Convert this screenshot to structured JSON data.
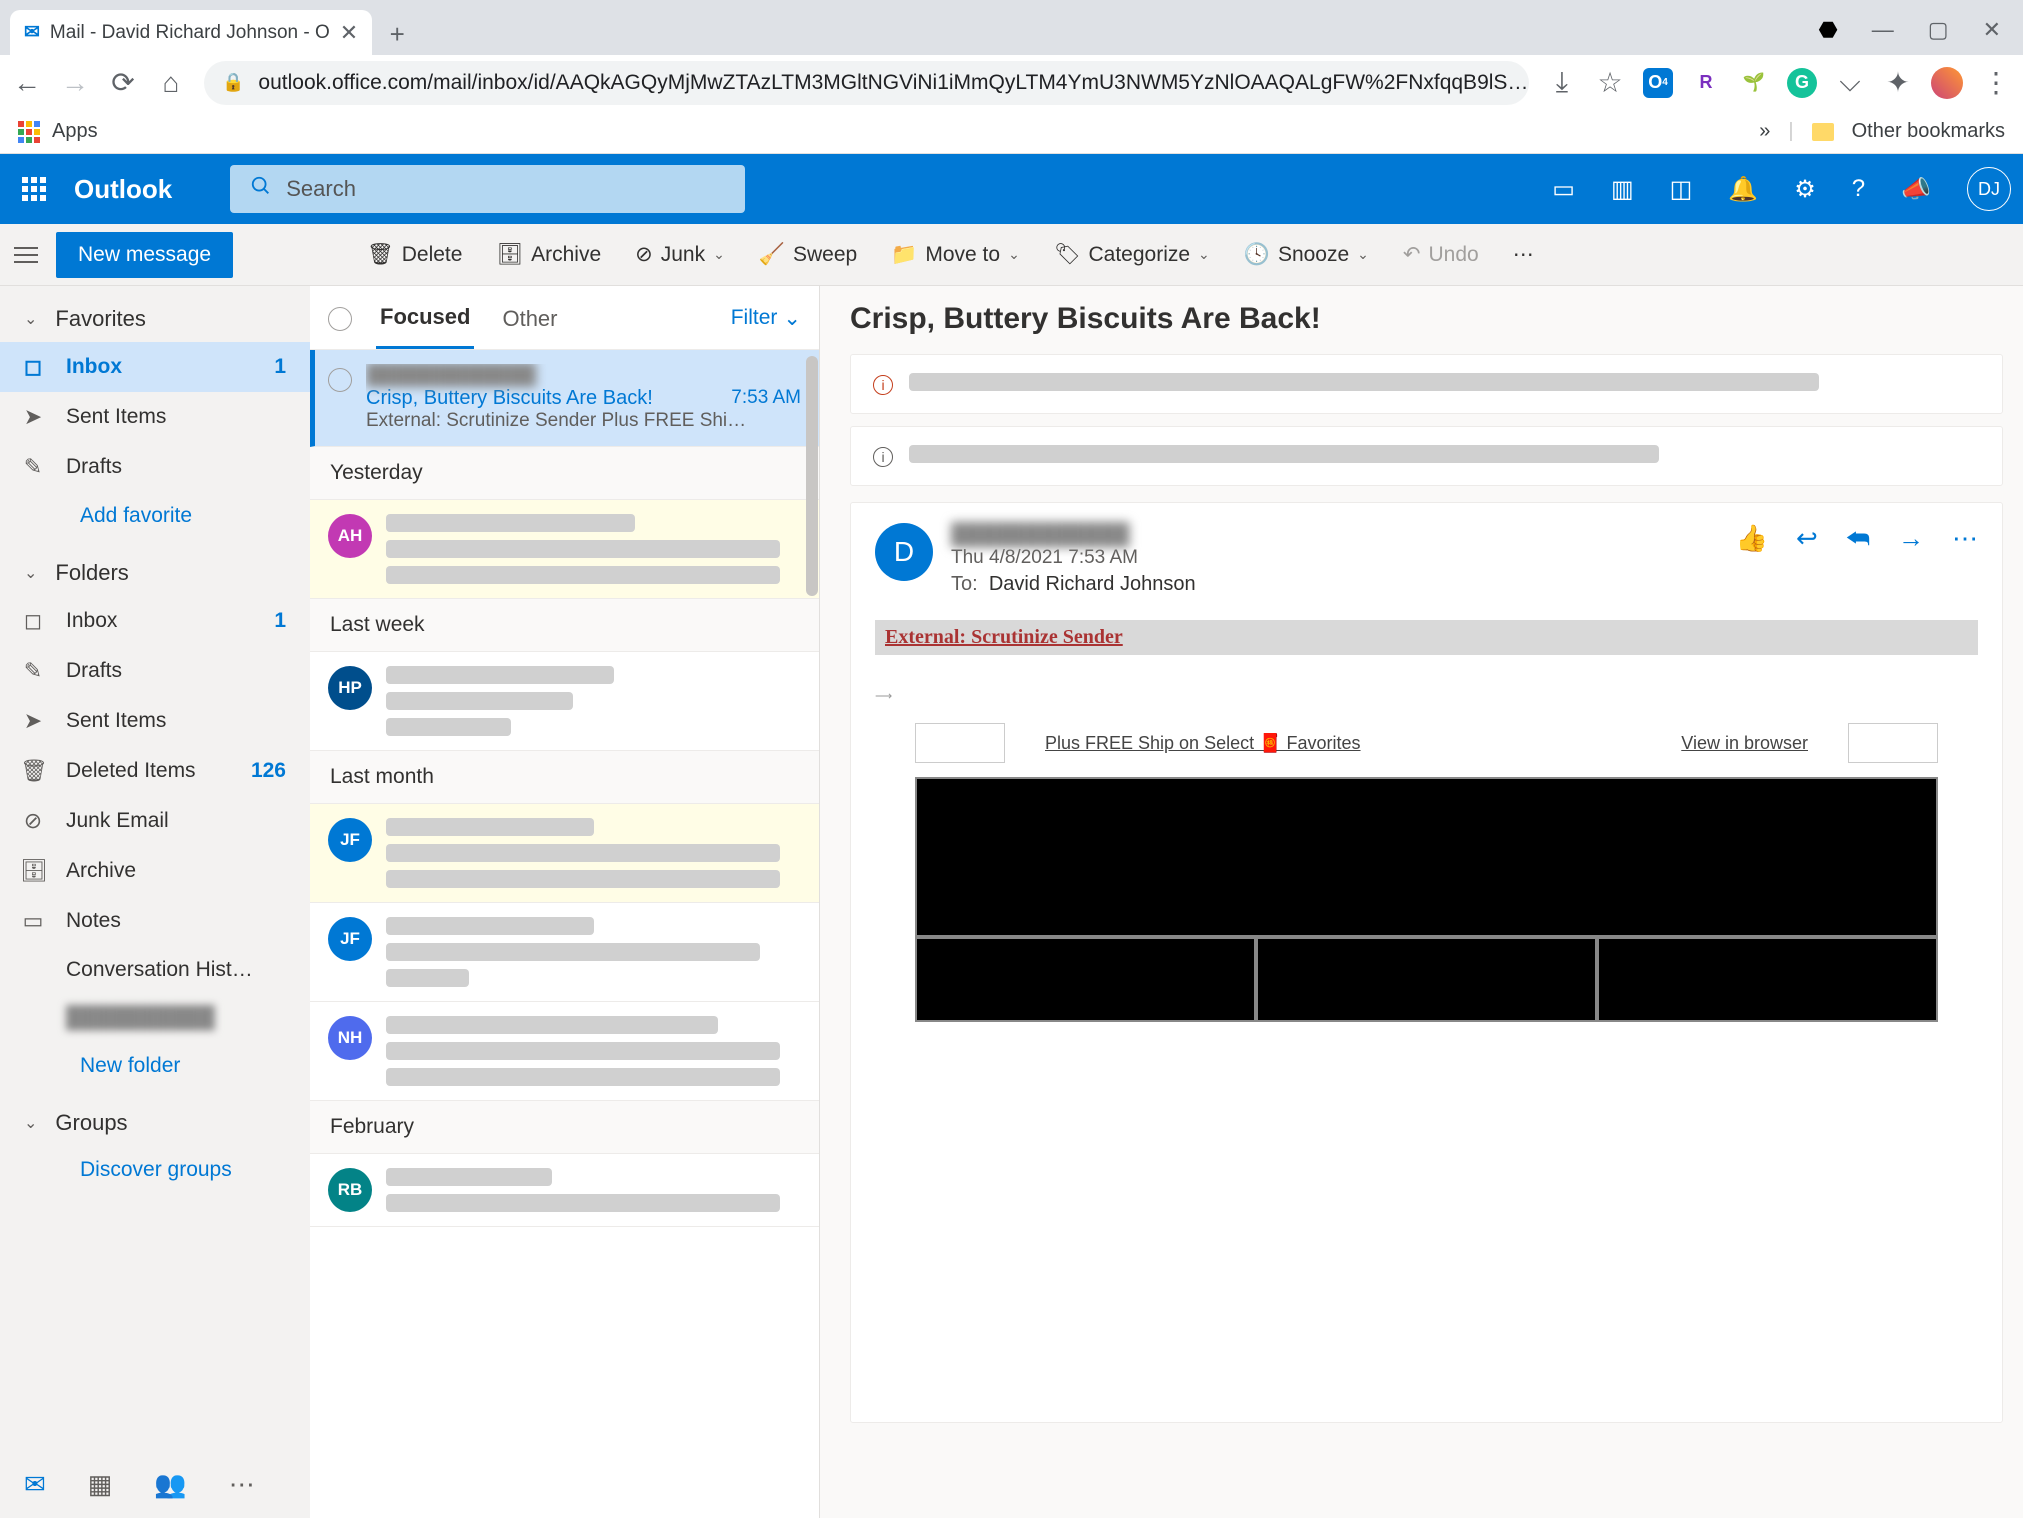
{
  "browser": {
    "tab_title": "Mail - David Richard Johnson - O",
    "url": "outlook.office.com/mail/inbox/id/AAQkAGQyMjMwZTAzLTM3MGltNGViNi1iMmQyLTM4YmU3NWM5YzNlOAAQALgFW%2FNxfqqB9lS…",
    "apps": "Apps",
    "other_bookmarks": "Other bookmarks"
  },
  "header": {
    "brand": "Outlook",
    "search_placeholder": "Search",
    "avatar": "DJ"
  },
  "toolbar": {
    "new_message": "New message",
    "delete": "Delete",
    "archive": "Archive",
    "junk": "Junk",
    "sweep": "Sweep",
    "move": "Move to",
    "categorize": "Categorize",
    "snooze": "Snooze",
    "undo": "Undo"
  },
  "nav": {
    "favorites": "Favorites",
    "folders": "Folders",
    "groups": "Groups",
    "fav_items": [
      {
        "icon": "inbox",
        "label": "Inbox",
        "count": "1",
        "sel": true
      },
      {
        "icon": "send",
        "label": "Sent Items"
      },
      {
        "icon": "draft",
        "label": "Drafts"
      }
    ],
    "add_favorite": "Add favorite",
    "folder_items": [
      {
        "icon": "inbox",
        "label": "Inbox",
        "count": "1"
      },
      {
        "icon": "draft",
        "label": "Drafts"
      },
      {
        "icon": "send",
        "label": "Sent Items"
      },
      {
        "icon": "trash",
        "label": "Deleted Items",
        "count": "126"
      },
      {
        "icon": "block",
        "label": "Junk Email"
      },
      {
        "icon": "archive",
        "label": "Archive"
      },
      {
        "icon": "note",
        "label": "Notes"
      },
      {
        "icon": "",
        "label": "Conversation Hist…"
      },
      {
        "icon": "",
        "label": "██████████",
        "blur": true
      }
    ],
    "new_folder": "New folder",
    "discover_groups": "Discover groups"
  },
  "list": {
    "focused": "Focused",
    "other": "Other",
    "filter": "Filter",
    "groups": [
      "Yesterday",
      "Last week",
      "Last month",
      "February"
    ],
    "first": {
      "sender": "████████████",
      "subject": "Crisp, Buttery Biscuits Are Back!",
      "time": "7:53 AM",
      "preview": "External: Scrutinize Sender Plus FREE Shi…"
    },
    "avatars": [
      {
        "txt": "AH",
        "bg": "#c239b3"
      },
      {
        "txt": "HP",
        "bg": "#004e8c"
      },
      {
        "txt": "JF",
        "bg": "#0078d4"
      },
      {
        "txt": "JF",
        "bg": "#0078d4"
      },
      {
        "txt": "NH",
        "bg": "#4f6bed"
      },
      {
        "txt": "RB",
        "bg": "#038387"
      }
    ]
  },
  "reader": {
    "title": "Crisp, Buttery Biscuits Are Back!",
    "avatar": "D",
    "date": "Thu 4/8/2021 7:53 AM",
    "to_label": "To:",
    "to_name": "David Richard Johnson",
    "banner": "External: Scrutinize Sender",
    "link1": "Plus FREE Ship on Select 🧧 Favorites",
    "link2": "View in browser"
  }
}
